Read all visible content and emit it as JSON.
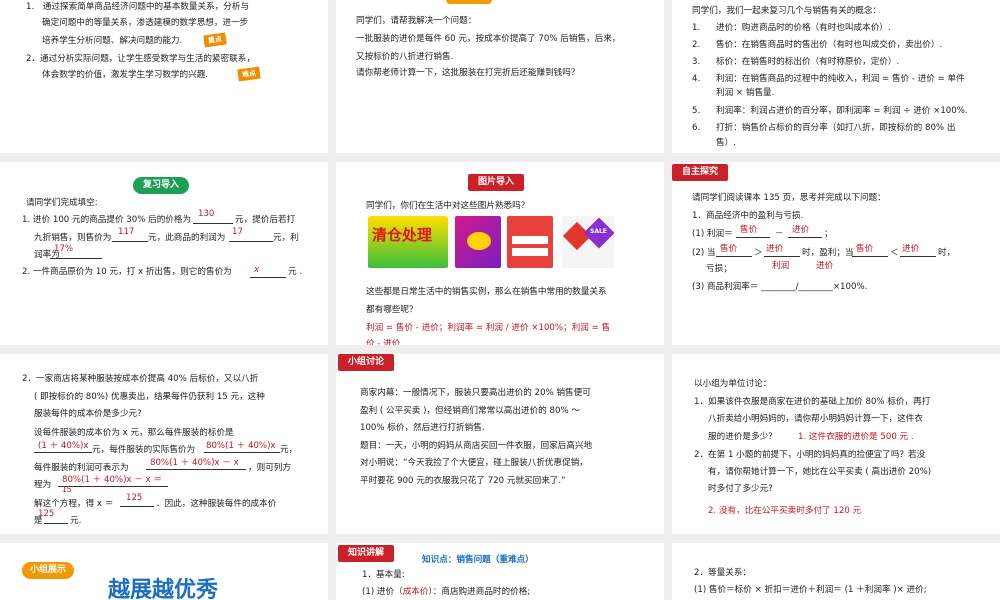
{
  "p1": {
    "item1a": "1.　通过探索简单商品经济问题中的基本数量关系，分析与",
    "item1b": "确定问题中的等量关系，渗透建模的数学思想，进一步",
    "item1c": "培养学生分析问题、解决问题的能力.",
    "badge1": "重点",
    "item2a": "2．通过分析实际问题，让学生感受数学与生活的紧密联系，",
    "item2b": "体会数学的价值，激发学生学习数学的兴趣.",
    "badge2": "难点"
  },
  "p2": {
    "l1": "同学们，请帮我解决一个问题：",
    "l2": "一批服装的进价是每件 60 元，按成本价提高了 70% 后销售，后来，",
    "l3": "又按标价的八折进行销售.",
    "l4": "请你帮老师计算一下，这批服装在打完折后还能赚到钱吗？"
  },
  "p3": {
    "intro": "同学们，我们一起来复习几个与销售有关的概念：",
    "items": [
      {
        "n": "1.",
        "t": "进价：购进商品时的价格（有时也叫成本价）."
      },
      {
        "n": "2.",
        "t": "售价：在销售商品时的售出价（有时也叫成交价，卖出价）."
      },
      {
        "n": "3.",
        "t": "标价：在销售时的标出价（有时称原价，定价）."
      },
      {
        "n": "4.",
        "t": "利润：在销售商品的过程中的纯收入，利润 = 售价 - 进价 = 单件"
      },
      {
        "n": "",
        "t": "利润 × 销售量."
      },
      {
        "n": "5.",
        "t": "利润率：利润占进价的百分率，即利润率 = 利润 ÷ 进价 ×100%."
      },
      {
        "n": "6.",
        "t": "打折：销售价占标价的百分率（如打八折，即按标价的 80% 出"
      },
      {
        "n": "",
        "t": "售）."
      }
    ]
  },
  "p4": {
    "tag": "复习导入",
    "l0": "请同学们完成填空:",
    "l1a": "1.  进价 100 元的商品提价 30% 后的价格为",
    "l1b": "元，提价后若打",
    "a130": "130",
    "l2a": "九折销售，则售价为",
    "a117": "117",
    "l2b": "元，此商品的利润为",
    "a17": "17",
    "l2c": "元，利",
    "l3a": "润率为",
    "a17p": "17%",
    "l4a": "2.  一件商品原价为 10 元，打 x 折出售，则它的售价为",
    "ax": "x",
    "l4b": "元 ."
  },
  "p5": {
    "tag": "图片导入",
    "l1": "同学们，你们在生活中对这些图片熟悉吗？",
    "promo1": "清仓处理",
    "promo4": "SALE",
    "l2": "这些都是日常生活中的销售实例，那么在销售中常用的数量关系",
    "l3": "都有哪些呢？",
    "l4": "利润 = 售价 - 进价；利润率 = 利润 / 进价 ×100%；利润 = 售",
    "l5": "价 - 进价"
  },
  "p6": {
    "tag": "自主探究",
    "l0": "请同学们阅读课本 135 页，思考并完成以下问题：",
    "l1": "1．商品经济中的盈利与亏损.",
    "l2a": "(1) 利润＝",
    "a_sj": "售价",
    "minus": "－",
    "a_jj": "进价",
    "l2b": "；",
    "l3a": "(2) 当",
    "a_sj2": "售价",
    "gt": "＞",
    "a_jj2": "进价",
    "l3b": "时，盈利；当",
    "a_sj3": "售价",
    "lt": "＜",
    "a_jj3": "进价",
    "l3c": "时，",
    "a_lr": "利润",
    "a_jj4": "进价",
    "l4": "亏损；",
    "l5": "(3) 商品利润率＝ ________/________×100%."
  },
  "p7": {
    "l1": "2．一家商店将某种服装按成本价提高 40% 后标价，又以八折",
    "l2": "( 即按标价的 80%) 优惠卖出，结果每件仍获利 15 元，这种",
    "l3": "服装每件的成本价是多少元?",
    "l4": "设每件服装的成本价为 x 元，那么每件服装的标价是",
    "a1": "(1 ＋ 40%)x",
    "l5a": "元，每件服装的实际售价为",
    "a2": "80%(1 ＋ 40%)x",
    "l5b": "元，",
    "l6a": "每件服装的利润可表示为",
    "a3": "80%(1 ＋ 40%)x － x",
    "l6b": "，则可列方",
    "l7a": "程为",
    "a4": "80%(1 ＋ 40%)x － x ＝",
    "a4b": "15",
    "l8a": "解这个方程，得 x ＝",
    "a5": "125",
    "l8b": "．因此，这种服装每件的成本价",
    "l9a": "是",
    "a6": "125",
    "l9b": "元."
  },
  "p8": {
    "tag": "小组讨论",
    "l1": "商家内幕：一般情况下，服装只要高出进价的 20% 销售便可",
    "l2": "盈利 ( 公平买卖 )，但经销商们常常以高出进价的 80% ～",
    "l3": "100% 标价，然后进行打折销售.",
    "l4": "题目：一天，小明的妈妈从商店买回一件衣服，回家后高兴地",
    "l5": "对小明说：“今天我捡了个大便宜，碰上服装八折优惠促销，",
    "l6": "平时要花 900 元的衣服我只花了 720 元就买回来了.”"
  },
  "p9": {
    "l0": "以小组为单位讨论：",
    "l1": "1．如果该件衣服是商家在进价的基础上加价 80% 标价，再打",
    "l2": "八折卖给小明妈妈的，请你帮小明妈妈计算一下，这件衣",
    "l3": "服的进价是多少？",
    "a1": "1. 这件衣服的进价是 500 元 .",
    "l4": "2．在第 1 小题的前提下，小明的妈妈真的捡便宜了吗？若没",
    "l5": "有，请你帮她计算一下，她比在公平买卖 ( 高出进价 20%)",
    "l6": "时多付了多少元?",
    "a2": "2. 没有，比在公平买卖时多付了 120 元"
  },
  "p10": {
    "tag": "小组展示",
    "title": "越展越优秀"
  },
  "p11": {
    "tag": "知识讲解",
    "point": "知识点：销售问题（重难点）",
    "l1": "1．基本量:",
    "l2a": "(1) 进价（",
    "l2r": "成本价",
    "l2b": "）：商店购进商品时的价格;"
  },
  "p12": {
    "l1": "2．等量关系：",
    "l2": "(1) 售价＝标价 × 折扣＝进价＋利润＝ (1 ＋利润率 )× 进价;"
  },
  "colors": {
    "red": "#c9202a",
    "green": "#1e9f56",
    "orange": "#f39800",
    "answer": "#c9151e",
    "title_blue": "#1b6fc2"
  }
}
